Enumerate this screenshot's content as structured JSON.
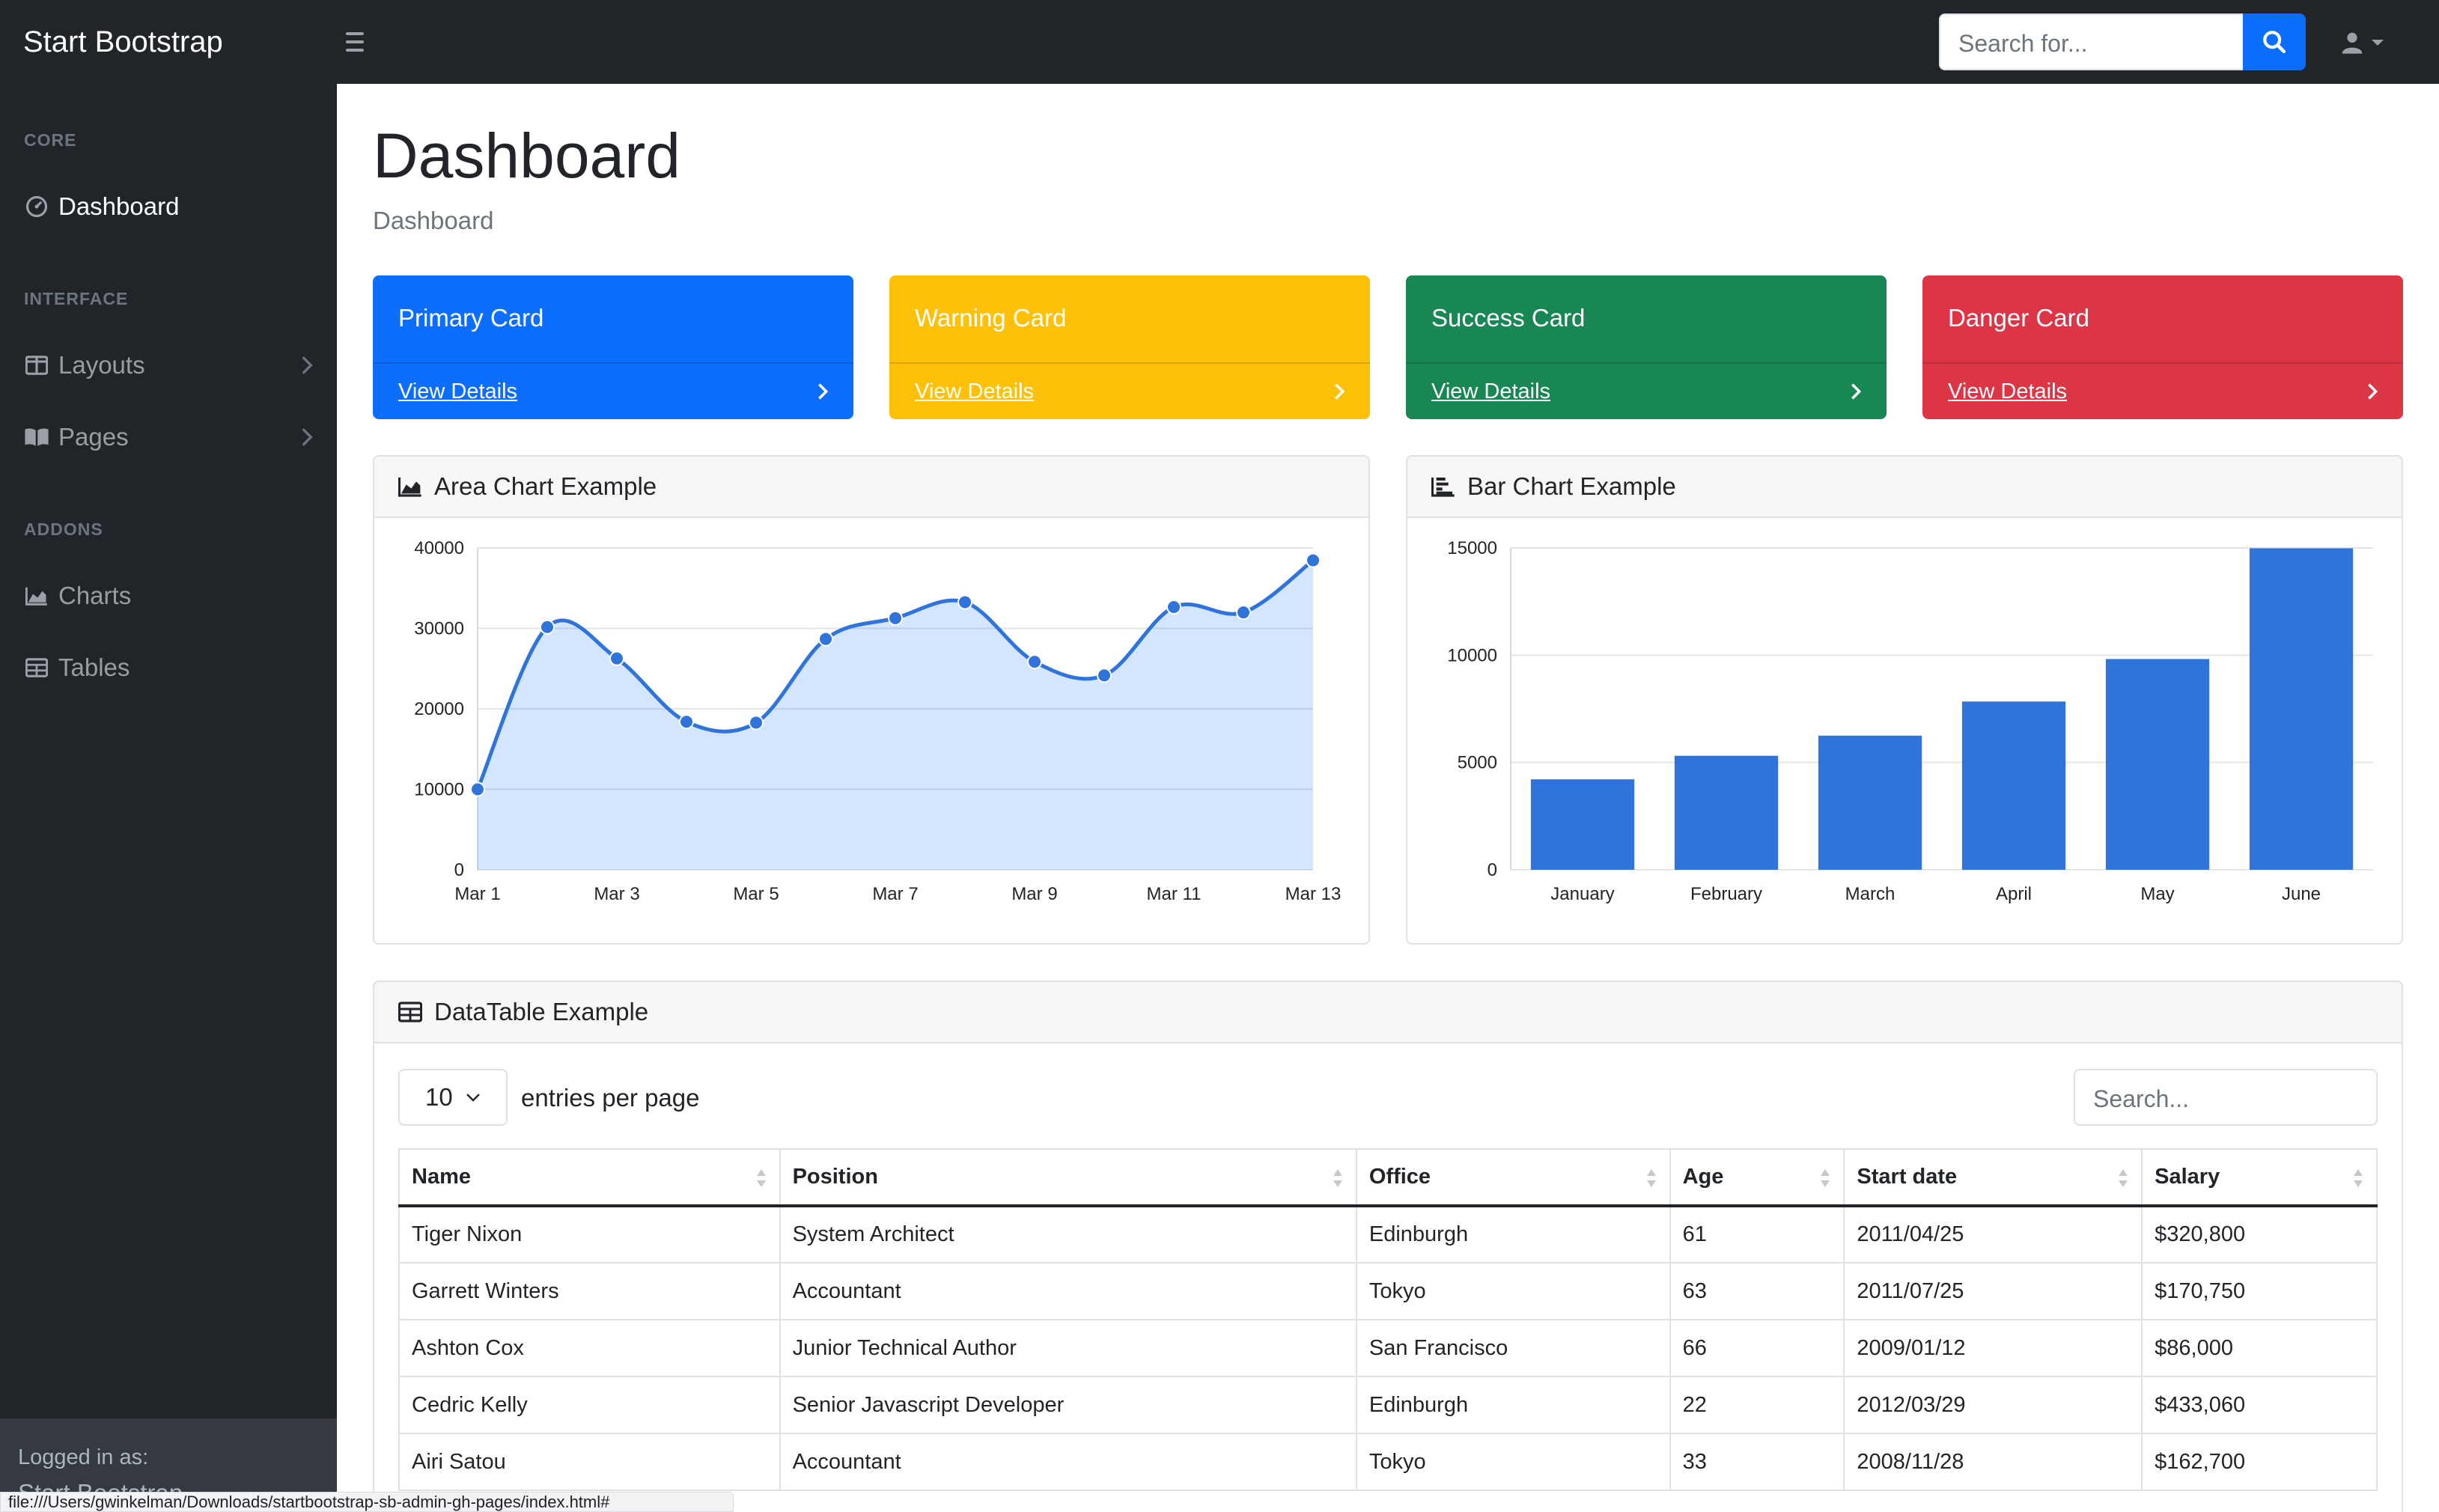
{
  "navbar": {
    "brand": "Start Bootstrap",
    "search_placeholder": "Search for...",
    "icons": {
      "toggle": "hamburger-icon",
      "search": "search-icon",
      "user": "user-icon"
    }
  },
  "sidebar": {
    "sections": [
      {
        "heading": "Core",
        "items": [
          {
            "label": "Dashboard",
            "icon": "tachometer-icon",
            "active": true
          }
        ]
      },
      {
        "heading": "Interface",
        "items": [
          {
            "label": "Layouts",
            "icon": "columns-icon",
            "chevron": true
          },
          {
            "label": "Pages",
            "icon": "book-open-icon",
            "chevron": true
          }
        ]
      },
      {
        "heading": "Addons",
        "items": [
          {
            "label": "Charts",
            "icon": "chart-area-icon"
          },
          {
            "label": "Tables",
            "icon": "table-icon"
          }
        ]
      }
    ],
    "footer": {
      "label": "Logged in as:",
      "user": "Start Bootstrap"
    }
  },
  "main": {
    "title": "Dashboard",
    "breadcrumb": "Dashboard",
    "cards": [
      {
        "title": "Primary Card",
        "link": "View Details",
        "color": "#0d6efd"
      },
      {
        "title": "Warning Card",
        "link": "View Details",
        "color": "#ffc107"
      },
      {
        "title": "Success Card",
        "link": "View Details",
        "color": "#198754"
      },
      {
        "title": "Danger Card",
        "link": "View Details",
        "color": "#dc3545"
      }
    ],
    "area_chart": {
      "title": "Area Chart Example",
      "icon": "chart-area-icon"
    },
    "bar_chart": {
      "title": "Bar Chart Example",
      "icon": "chart-bar-icon"
    },
    "datatable": {
      "title": "DataTable Example",
      "icon": "table-icon",
      "page_size": "10",
      "per_page_label": "entries per page",
      "search_placeholder": "Search...",
      "columns": [
        "Name",
        "Position",
        "Office",
        "Age",
        "Start date",
        "Salary"
      ],
      "rows": [
        [
          "Tiger Nixon",
          "System Architect",
          "Edinburgh",
          "61",
          "2011/04/25",
          "$320,800"
        ],
        [
          "Garrett Winters",
          "Accountant",
          "Tokyo",
          "63",
          "2011/07/25",
          "$170,750"
        ],
        [
          "Ashton Cox",
          "Junior Technical Author",
          "San Francisco",
          "66",
          "2009/01/12",
          "$86,000"
        ],
        [
          "Cedric Kelly",
          "Senior Javascript Developer",
          "Edinburgh",
          "22",
          "2012/03/29",
          "$433,060"
        ],
        [
          "Airi Satou",
          "Accountant",
          "Tokyo",
          "33",
          "2008/11/28",
          "$162,700"
        ]
      ]
    }
  },
  "status_url": "file:///Users/gwinkelman/Downloads/startbootstrap-sb-admin-gh-pages/index.html#",
  "chart_data": [
    {
      "type": "area",
      "categories": [
        "Mar 1",
        "Mar 2",
        "Mar 3",
        "Mar 4",
        "Mar 5",
        "Mar 6",
        "Mar 7",
        "Mar 8",
        "Mar 9",
        "Mar 10",
        "Mar 11",
        "Mar 12",
        "Mar 13"
      ],
      "x_tick_labels": [
        "Mar 1",
        "Mar 3",
        "Mar 5",
        "Mar 7",
        "Mar 9",
        "Mar 11",
        "Mar 13"
      ],
      "values": [
        10000,
        30162,
        26263,
        18394,
        18287,
        28682,
        31274,
        33259,
        25849,
        24159,
        32651,
        31984,
        38451
      ],
      "ylim": [
        0,
        40000
      ],
      "yticks": [
        0,
        10000,
        20000,
        30000,
        40000
      ],
      "grid": true,
      "color": "#0d6efd"
    },
    {
      "type": "bar",
      "categories": [
        "January",
        "February",
        "March",
        "April",
        "May",
        "June"
      ],
      "values": [
        4215,
        5312,
        6251,
        7841,
        9821,
        14984
      ],
      "ylim": [
        0,
        15000
      ],
      "yticks": [
        0,
        5000,
        10000,
        15000
      ],
      "grid": true,
      "color": "#0d6efd"
    }
  ]
}
